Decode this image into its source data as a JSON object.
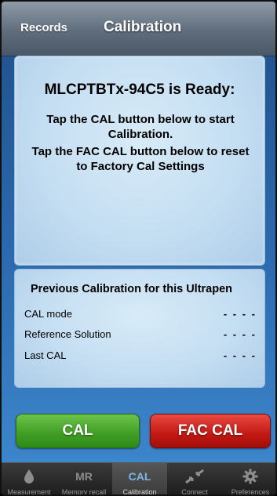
{
  "header": {
    "records_label": "Records",
    "title": "Calibration"
  },
  "status": {
    "ready_text": "MLCPTBTx-94C5 is Ready:",
    "instruction_cal": "Tap the CAL button below to start Calibration.",
    "instruction_fac": "Tap the FAC CAL button below to reset to Factory Cal Settings"
  },
  "previous": {
    "title": "Previous Calibration for this Ultrapen",
    "rows": [
      {
        "label": "CAL mode",
        "value": "- - - -"
      },
      {
        "label": "Reference Solution",
        "value": "- - - -"
      },
      {
        "label": "Last CAL",
        "value": "- - - -"
      }
    ]
  },
  "actions": {
    "cal_label": "CAL",
    "fac_cal_label": "FAC CAL"
  },
  "tabs": [
    {
      "icon": "drop-icon",
      "icon_text": "",
      "label": "Measurement"
    },
    {
      "icon": "mr-text-icon",
      "icon_text": "MR",
      "label": "Memory recall"
    },
    {
      "icon": "cal-text-icon",
      "icon_text": "CAL",
      "label": "Calibration"
    },
    {
      "icon": "connect-arrows-icon",
      "icon_text": "",
      "label": "Connect"
    },
    {
      "icon": "gear-icon",
      "icon_text": "",
      "label": "Preferences"
    }
  ],
  "colors": {
    "cal_button": "#3f9d24",
    "fac_cal_button": "#c31813",
    "active_tab_accent": "#7fb6e8"
  }
}
